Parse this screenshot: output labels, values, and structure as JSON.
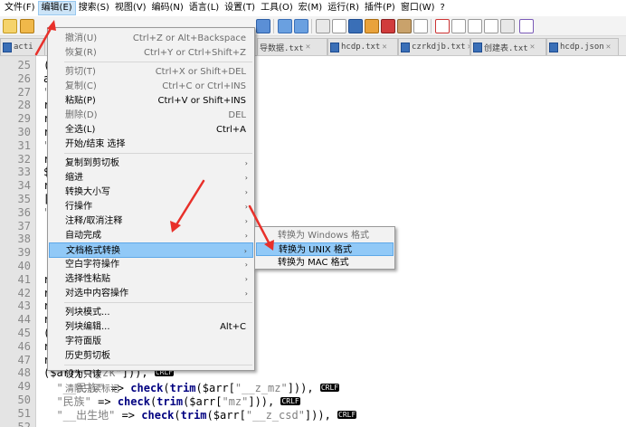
{
  "menubar": [
    {
      "label": "文件(F)",
      "active": false
    },
    {
      "label": "编辑(E)",
      "active": true
    },
    {
      "label": "搜索(S)",
      "active": false
    },
    {
      "label": "视图(V)",
      "active": false
    },
    {
      "label": "编码(N)",
      "active": false
    },
    {
      "label": "语言(L)",
      "active": false
    },
    {
      "label": "设置(T)",
      "active": false
    },
    {
      "label": "工具(O)",
      "active": false
    },
    {
      "label": "宏(M)",
      "active": false
    },
    {
      "label": "运行(R)",
      "active": false
    },
    {
      "label": "插件(P)",
      "active": false
    },
    {
      "label": "窗口(W)",
      "active": false
    },
    {
      "label": "?",
      "active": false
    }
  ],
  "tabs": [
    {
      "label": "acti",
      "active": false
    },
    {
      "label": "导数据.txt",
      "active": false
    },
    {
      "label": "hcdp.txt",
      "active": false
    },
    {
      "label": "czrkdjb.txt",
      "active": false
    },
    {
      "label": "创建表.txt",
      "active": false
    },
    {
      "label": "hcdp.json",
      "active": false
    }
  ],
  "editor": {
    "eol_marker": "CRLF",
    "lines": [
      {
        "num": "25",
        "text": "(trim($arr[\"djsj\"])),"
      },
      {
        "num": "26",
        "text": "arr[\"sfzh\"])),"
      },
      {
        "num": "27",
        "text": "\"xm\"])),"
      },
      {
        "num": "28",
        "text": "rr[\"cym\"])),"
      },
      {
        "num": "29",
        "text": "rr[\"rybh\"])),"
      },
      {
        "num": "30",
        "text": "rr[\"xxzz\"])),"
      },
      {
        "num": "31",
        "text": "\"zy\"])),"
      },
      {
        "num": "32",
        "text": "rr[\"sfzx\"])),"
      },
      {
        "num": "33",
        "text": "$arr[\"__z_djjg\"])),"
      },
      {
        "num": "34",
        "text": "rr[\"djjg\"])),"
      },
      {
        "num": "35",
        "text": "[\"__z_jg\"])),"
      },
      {
        "num": "36",
        "text": "\"jg\"])),"
      },
      {
        "num": "37",
        "text": ""
      },
      {
        "num": "38",
        "text": ""
      },
      {
        "num": "39",
        "text": ""
      },
      {
        "num": "40",
        "text": ""
      },
      {
        "num": "41",
        "text": "rim($arr[\"__z_whcd\"])),"
      },
      {
        "num": "42",
        "text": "rr[\"whcd\"])),"
      },
      {
        "num": "43",
        "text": "rim($arr[\"__z_byzk\"])),"
      },
      {
        "num": "44",
        "text": "rr[\"byzk\"])),"
      },
      {
        "num": "45",
        "text": "($arr[\"__z_jtgx\"])),"
      },
      {
        "num": "46",
        "text": "rr[\"jtgx\"])),"
      },
      {
        "num": "47",
        "text": "rim($arr[\"__z_hyzk\"])),"
      },
      {
        "num": "48",
        "text": "($arr[\"hyzk\"])),"
      },
      {
        "num": "49",
        "text": "  \"__民族\" => check(trim($arr[\"__z_mz\"])),"
      },
      {
        "num": "50",
        "text": "  \"民族\" => check(trim($arr[\"mz\"])),"
      },
      {
        "num": "51",
        "text": "  \"__出生地\" => check(trim($arr[\"__z_csd\"])),"
      },
      {
        "num": "52",
        "text": ""
      }
    ]
  },
  "edit_menu": {
    "items": [
      {
        "type": "item",
        "label": "撤消(U)",
        "shortcut": "Ctrl+Z or Alt+Backspace",
        "disabled": true
      },
      {
        "type": "item",
        "label": "恢复(R)",
        "shortcut": "Ctrl+Y or Ctrl+Shift+Z",
        "disabled": true
      },
      {
        "type": "sep"
      },
      {
        "type": "item",
        "label": "剪切(T)",
        "shortcut": "Ctrl+X or Shift+DEL",
        "disabled": true
      },
      {
        "type": "item",
        "label": "复制(C)",
        "shortcut": "Ctrl+C or Ctrl+INS",
        "disabled": true
      },
      {
        "type": "item",
        "label": "粘贴(P)",
        "shortcut": "Ctrl+V or Shift+INS",
        "disabled": false
      },
      {
        "type": "item",
        "label": "删除(D)",
        "shortcut": "DEL",
        "disabled": true
      },
      {
        "type": "item",
        "label": "全选(L)",
        "shortcut": "Ctrl+A",
        "disabled": false
      },
      {
        "type": "item",
        "label": "开始/结束 选择",
        "shortcut": "",
        "disabled": false
      },
      {
        "type": "sep"
      },
      {
        "type": "sub",
        "label": "复制到剪切板",
        "disabled": false
      },
      {
        "type": "sub",
        "label": "缩进",
        "disabled": false
      },
      {
        "type": "sub",
        "label": "转换大小写",
        "disabled": false
      },
      {
        "type": "sub",
        "label": "行操作",
        "disabled": false
      },
      {
        "type": "sub",
        "label": "注释/取消注释",
        "disabled": false
      },
      {
        "type": "sub",
        "label": "自动完成",
        "disabled": false
      },
      {
        "type": "sub",
        "label": "文档格式转换",
        "disabled": false,
        "highlighted": true
      },
      {
        "type": "sub",
        "label": "空白字符操作",
        "disabled": false
      },
      {
        "type": "sub",
        "label": "选择性粘贴",
        "disabled": false
      },
      {
        "type": "sub",
        "label": "对选中内容操作",
        "disabled": false
      },
      {
        "type": "sep"
      },
      {
        "type": "item",
        "label": "列块模式...",
        "shortcut": "",
        "disabled": false
      },
      {
        "type": "item",
        "label": "列块编辑...",
        "shortcut": "Alt+C",
        "disabled": false
      },
      {
        "type": "item",
        "label": "字符面版",
        "shortcut": "",
        "disabled": false
      },
      {
        "type": "item",
        "label": "历史剪切板",
        "shortcut": "",
        "disabled": false
      },
      {
        "type": "sep"
      },
      {
        "type": "item",
        "label": "设为只读",
        "shortcut": "",
        "disabled": false
      },
      {
        "type": "item",
        "label": "清除只读标记",
        "shortcut": "",
        "disabled": true
      }
    ]
  },
  "submenu": {
    "items": [
      {
        "label": "转换为 Windows 格式",
        "disabled": true,
        "highlighted": false
      },
      {
        "label": "转换为 UNIX 格式",
        "disabled": false,
        "highlighted": true
      },
      {
        "label": "转换为 MAC 格式",
        "disabled": false,
        "highlighted": false
      }
    ]
  },
  "colors": {
    "menu_highlight": "#91c9f7",
    "annotation_arrow": "#e8302a"
  }
}
